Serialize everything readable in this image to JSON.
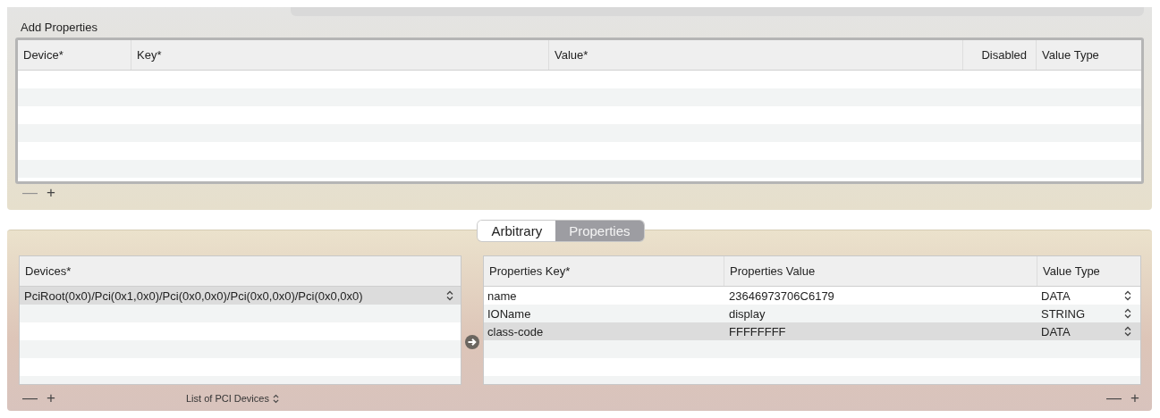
{
  "add_properties": {
    "title": "Add Properties",
    "table": {
      "columns": [
        "Device*",
        "Key*",
        "Value*",
        "Disabled",
        "Value Type"
      ]
    },
    "buttons": [
      {
        "label": "—",
        "disabled": true
      },
      {
        "label": "+",
        "disabled": false
      }
    ]
  },
  "mode_tabs": [
    {
      "label": "Arbitrary",
      "selected": false
    },
    {
      "label": "Properties",
      "selected": true
    }
  ],
  "devices": {
    "columns": [
      "Devices*"
    ],
    "rows": [
      {
        "path": "PciRoot(0x0)/Pci(0x1,0x0)/Pci(0x0,0x0)/Pci(0x0,0x0)/Pci(0x0,0x0)",
        "selected": true
      }
    ],
    "buttons": [
      {
        "label": "—",
        "disabled": false
      },
      {
        "label": "+",
        "disabled": false
      }
    ],
    "list_popup": "List of PCI Devices"
  },
  "properties": {
    "columns": [
      "Properties Key*",
      "Properties Value",
      "Value Type"
    ],
    "rows": [
      {
        "key": "name",
        "value": "23646973706C6179",
        "type": "DATA",
        "selected": false
      },
      {
        "key": "IOName",
        "value": "display",
        "type": "STRING",
        "selected": false
      },
      {
        "key": "class-code",
        "value": "FFFFFFFF",
        "type": "DATA",
        "selected": true
      }
    ],
    "buttons": [
      {
        "label": "—",
        "disabled": false
      },
      {
        "label": "+",
        "disabled": false
      }
    ]
  }
}
